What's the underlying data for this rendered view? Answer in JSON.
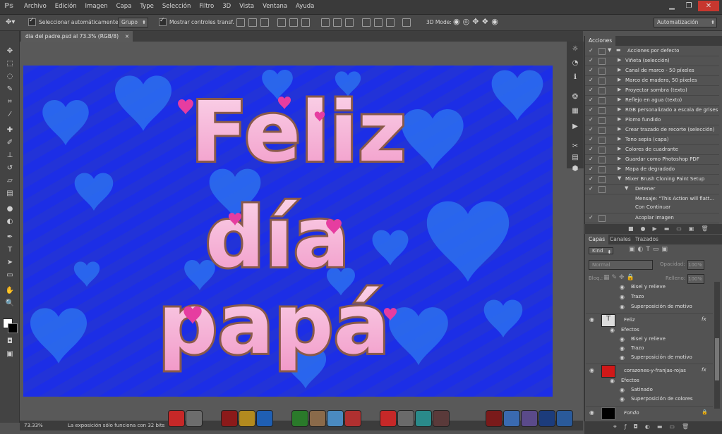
{
  "menubar": {
    "logo": "Ps",
    "items": [
      "Archivo",
      "Edición",
      "Imagen",
      "Capa",
      "Type",
      "Selección",
      "Filtro",
      "3D",
      "Vista",
      "Ventana",
      "Ayuda"
    ]
  },
  "options": {
    "auto_select_label": "Seleccionar automáticamente:",
    "auto_select_value": "Grupo",
    "show_transform_label": "Mostrar controles transf.",
    "mode3d_label": "3D Mode:",
    "workspace": "Automatización"
  },
  "document": {
    "tab_title": "dia del padre.psd al 73.3% (RGB/8)",
    "zoom": "73.33%",
    "status_text": "La exposición sólo funciona con 32 bits",
    "canvas_text": [
      "Feliz",
      "día",
      "papá"
    ]
  },
  "actions_panel": {
    "tab": "Acciones",
    "set_name": "Acciones por defecto",
    "items": [
      "Viñeta (selección)",
      "Canal de marco - 50 píxeles",
      "Marco de madera, 50 píxeles",
      "Proyectar sombra (texto)",
      "Reflejo en agua (texto)",
      "RGB personalizado a escala de grises",
      "Plomo fundido",
      "Crear trazado de recorte (selección)",
      "Tono sepia (capa)",
      "Colores de cuadrante",
      "Guardar como Photoshop PDF",
      "Mapa de degradado",
      "Mixer Brush Cloning Paint Setup"
    ],
    "sub_step": "Detener",
    "message": "Mensaje: \"This Action will flatt...",
    "continue": "Con Continuar",
    "last_step": "Acoplar imagen"
  },
  "layers_panel": {
    "tabs": [
      "Capas",
      "Canales",
      "Trazados"
    ],
    "kind": "Kind",
    "blend_mode": "Normal",
    "opacity_label": "Opacidad:",
    "opacity_value": "100%",
    "lock_label": "Bloq.:",
    "fill_label": "Relleno:",
    "fill_value": "100%",
    "effects_top": [
      "Bisel y relieve",
      "Trazo",
      "Superposición de motivo"
    ],
    "layer_feliz": "Feliz",
    "effects_label": "Efectos",
    "effects_feliz": [
      "Bisel y relieve",
      "Trazo",
      "Superposición de motivo"
    ],
    "layer_hearts": "corazones-y-franjas-rojas",
    "effects_hearts": [
      "Satinado",
      "Superposición de colores"
    ],
    "layer_background": "Fondo",
    "fx": "fx"
  },
  "colors": {
    "canvas_blue": "#1c2ee6",
    "heart_blue": "#2e74f0",
    "letter_pink": "#f4b8d8",
    "letter_border": "#8a5a4a"
  }
}
